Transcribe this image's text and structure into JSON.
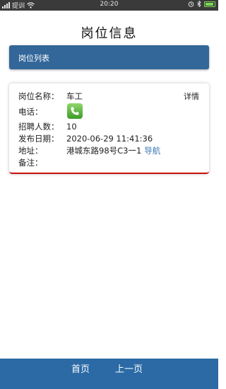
{
  "status_bar": {
    "carrier": "提训",
    "time": "20:20"
  },
  "header": {
    "title": "岗位信息"
  },
  "list_header": {
    "label": "岗位列表"
  },
  "job": {
    "detail_label": "详情",
    "fields": {
      "position_label": "岗位名称：",
      "position_value": "车工",
      "phone_label": "电话：",
      "headcount_label": "招聘人数：",
      "headcount_value": "10",
      "date_label": "发布日期：",
      "date_value": "2020-06-29 11:41:36",
      "address_label": "地址：",
      "address_value": "港城东路98号C3一1",
      "navigate_label": "导航",
      "remark_label": "备注：",
      "remark_value": ""
    }
  },
  "bottom_nav": {
    "home_label": "首页",
    "prev_label": "上一页"
  },
  "colors": {
    "list_header_bg": "#336699",
    "bottom_bar_bg": "#2b6aa5",
    "card_accent": "#cc1111",
    "link": "#3a77b5",
    "phone_green": "#4caf3a"
  },
  "icons": [
    "signal-icon",
    "wifi-icon",
    "alarm-icon",
    "bluetooth-icon",
    "battery-icon",
    "phone-icon"
  ]
}
